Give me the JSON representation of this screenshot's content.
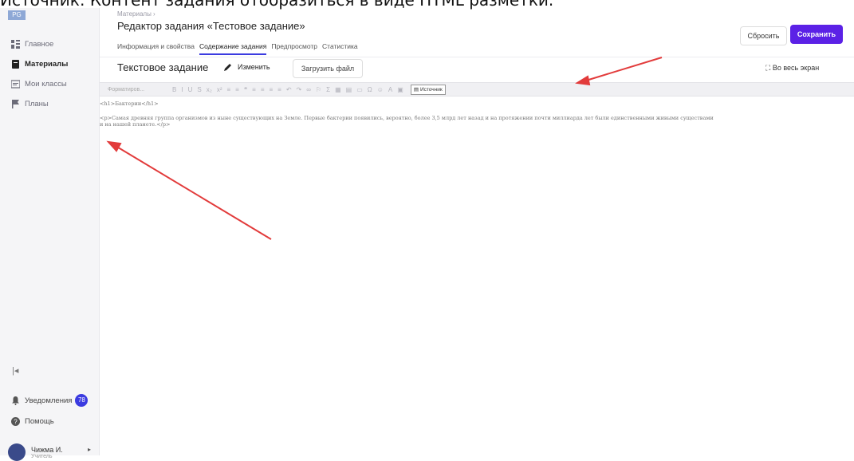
{
  "caption": "Источник: Контент задания отобразиться в виде HTML разметки.",
  "logo": "PG",
  "sidebar": {
    "items": [
      {
        "label": "Главное",
        "icon": "grid-icon",
        "active": false
      },
      {
        "label": "Материалы",
        "icon": "book-icon",
        "active": true
      },
      {
        "label": "Мои классы",
        "icon": "classes-icon",
        "active": false
      },
      {
        "label": "Планы",
        "icon": "flag-icon",
        "active": false
      }
    ],
    "collapse": "|◂",
    "notifications": {
      "label": "Уведомления",
      "count": "78"
    },
    "help": "Помощь",
    "user": {
      "name": "Чижма И.",
      "role": "Учитель"
    }
  },
  "header": {
    "breadcrumb": "Материалы ›",
    "title": "Редактор задания «Тестовое задание»",
    "reset": "Сбросить",
    "save": "Сохранить",
    "tabs": [
      {
        "label": "Информация и свойства",
        "active": false
      },
      {
        "label": "Содержание задания",
        "active": true
      },
      {
        "label": "Предпросмотр",
        "active": false
      },
      {
        "label": "Статистика",
        "active": false
      }
    ]
  },
  "content": {
    "section_title": "Текстовое задание",
    "edit": "Изменить",
    "upload": "Загрузить файл",
    "fullscreen": "Во весь экран",
    "toolbar": {
      "format": "Форматиров...",
      "buttons": [
        "B",
        "I",
        "U",
        "S",
        "x₂",
        "x²",
        "≡",
        "≡",
        "❝",
        "≡",
        "≡",
        "≡",
        "≡",
        "↶",
        "↷",
        "∞",
        "⚐",
        "Σ",
        "▦",
        "▤",
        "▭",
        "Ω",
        "☺",
        "A",
        "▣"
      ],
      "source": "Источник"
    },
    "code": [
      "<h1>Бактерии</h1>",
      "<p>Самая древняя группа организмов из ныне существующих на Земле. Первые бактерии появились, вероятно, более 3,5 млрд лет назад и на протяжении почти миллиарда лет были единственными живыми существами",
      "и на нашей планете.</p>"
    ]
  },
  "colors": {
    "accent": "#5b21e6",
    "badge": "#3b3be0",
    "arrow": "#e23b3b"
  }
}
